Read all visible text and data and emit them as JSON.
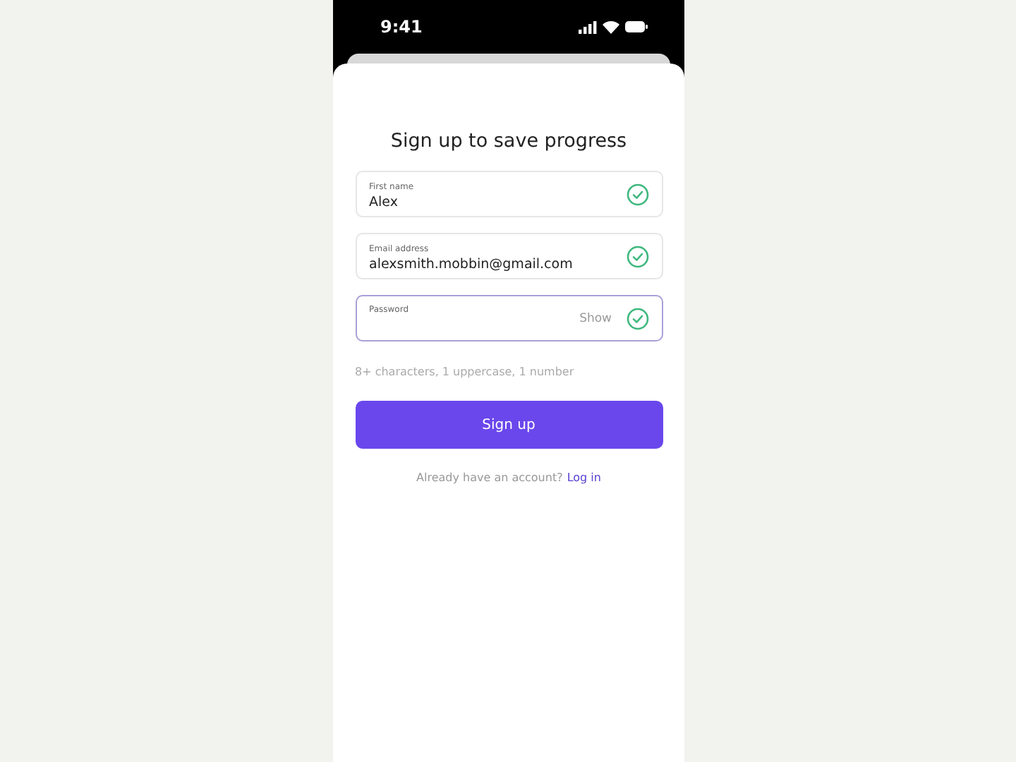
{
  "status_bar": {
    "time": "9:41"
  },
  "title": "Sign up to save progress",
  "fields": [
    {
      "label": "First name",
      "value": "Alex",
      "valid": true,
      "focused": false
    },
    {
      "label": "Email address",
      "value": "alexsmith.mobbin@gmail.com",
      "valid": true,
      "focused": false
    },
    {
      "label": "Password",
      "toggle": "Show",
      "valid": true,
      "focused": true
    }
  ],
  "hint": "8+ characters, 1 uppercase, 1 number",
  "submit_button": "Sign up",
  "footer": {
    "text": "Already have an account?",
    "link": "Log in"
  }
}
